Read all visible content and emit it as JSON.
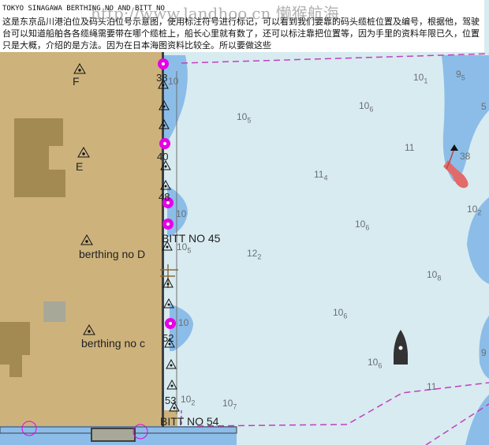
{
  "caption": {
    "title": "TOKYO SINAGAWA BERTHING NO AND BITT NO",
    "body": "这是东京品川港泊位及码头泊位号示意图，使用标注符号进行标记，可以看到我们要靠的码头缆桩位置及编号，根据他，驾驶台可以知道船舶各各缆绳需要带在哪个缆桩上，船长心里就有数了，还可以标注靠把位置等，因为手里的资料年限已久，位置只是大概，介绍的是方法。因为在日本海图资料比较全。所以要做这些"
  },
  "watermark": "http://www.landhoo.cn 懒猴航海",
  "berths": [
    "F",
    "E",
    "berthing no D",
    "berthing no c"
  ],
  "bitts": [
    "38",
    "40",
    "48",
    "52",
    "53"
  ],
  "bitt_labels": [
    "BITT NO 45",
    "BITT NO 54"
  ],
  "depths": [
    {
      "main": "10",
      "sub": "1"
    },
    {
      "main": "9",
      "sub": "5"
    },
    {
      "main": "10",
      "sub": "6"
    },
    {
      "main": "10",
      "sub": "5"
    },
    {
      "main": "11",
      "sub": ""
    },
    {
      "main": "11",
      "sub": "4"
    },
    {
      "main": "10",
      "sub": "2"
    },
    {
      "main": "10",
      "sub": "6"
    },
    {
      "main": "12",
      "sub": "2"
    },
    {
      "main": "10",
      "sub": "5"
    },
    {
      "main": "10",
      "sub": "8"
    },
    {
      "main": "10",
      "sub": "6"
    },
    {
      "main": "10",
      "sub": "6"
    },
    {
      "main": "11",
      "sub": ""
    },
    {
      "main": "10",
      "sub": "2"
    },
    {
      "main": "10",
      "sub": "7"
    },
    {
      "main": "10",
      "sub": ""
    },
    {
      "main": "10",
      "sub": ""
    },
    {
      "main": "10",
      "sub": ""
    },
    {
      "main": "5",
      "sub": ""
    },
    {
      "main": "9",
      "sub": ""
    },
    {
      "main": "38",
      "sub": ""
    }
  ],
  "colors": {
    "land": "#cdb27c",
    "building": "#a28a52",
    "shallow_water": "#8bbde8",
    "deep_water": "#d8ebf0",
    "bitt_marker": "#e600e6",
    "track_line": "#c040c0"
  }
}
